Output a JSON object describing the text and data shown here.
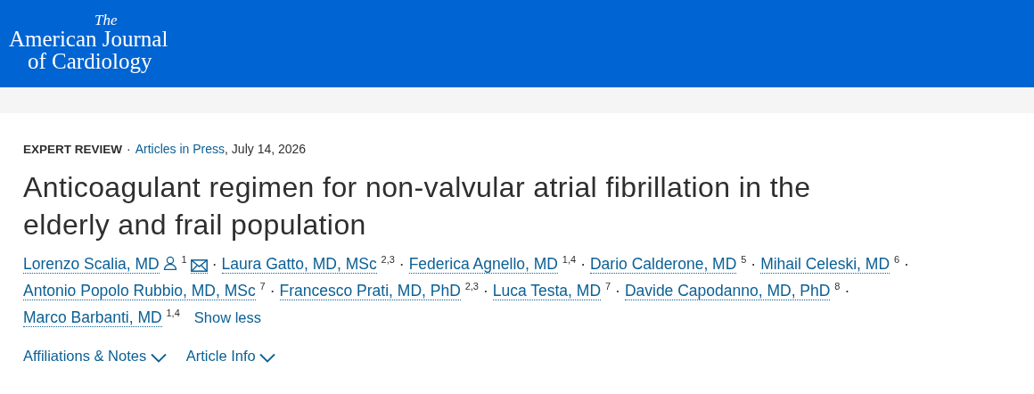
{
  "header": {
    "logo_lines": [
      "The",
      "American Journal",
      "of Cardiology"
    ]
  },
  "article": {
    "type": "EXPERT REVIEW",
    "type_separator": "·",
    "issue_link": "Articles in Press",
    "date": ", July 14, 2026",
    "title": "Anticoagulant regimen for non-valvular atrial fibrillation in the elderly and frail population",
    "author_lines": [
      [
        {
          "name": "Lorenzo Scalia, MD",
          "corresponding": true,
          "affiliations": "1",
          "separator": "·"
        },
        {
          "name": "Laura Gatto, MD, MSc",
          "corresponding": false,
          "affiliations": "2,3",
          "separator": "·"
        },
        {
          "name": "Federica Agnello, MD",
          "corresponding": false,
          "affiliations": "1,4",
          "separator": "·"
        },
        {
          "name": "Dario Calderone, MD",
          "corresponding": false,
          "affiliations": "5",
          "separator": "·"
        },
        {
          "name": "Mihail Celeski, MD",
          "corresponding": false,
          "affiliations": "6",
          "separator": "·"
        }
      ],
      [
        {
          "name": "Antonio Popolo Rubbio, MD, MSc",
          "corresponding": false,
          "affiliations": "7",
          "separator": "·"
        },
        {
          "name": "Francesco Prati, MD, PhD",
          "corresponding": false,
          "affiliations": "2,3",
          "separator": "·"
        },
        {
          "name": "Luca Testa, MD",
          "corresponding": false,
          "affiliations": "7",
          "separator": "·"
        },
        {
          "name": "Davide Capodanno, MD, PhD",
          "corresponding": false,
          "affiliations": "8",
          "separator": "·"
        }
      ],
      [
        {
          "name": "Marco Barbanti, MD",
          "corresponding": false,
          "affiliations": "1,4"
        }
      ]
    ],
    "show_toggle": "Show less",
    "sections": [
      {
        "label": "Affiliations & Notes",
        "expanded": false
      },
      {
        "label": "Article Info",
        "expanded": false
      }
    ]
  }
}
